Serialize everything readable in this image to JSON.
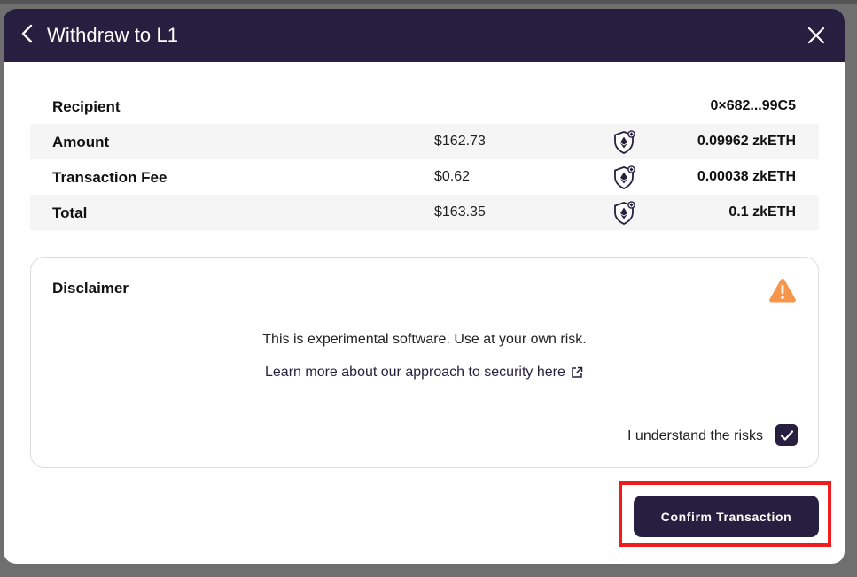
{
  "modal": {
    "title": "Withdraw to L1",
    "back_icon": "chevron-left-icon",
    "close_icon": "close-icon"
  },
  "summary": {
    "rows": [
      {
        "label": "Recipient",
        "usd": "",
        "value": "0×682...99C5",
        "token_icon": ""
      },
      {
        "label": "Amount",
        "usd": "$162.73",
        "value": "0.09962 zkETH",
        "token_icon": "shield-eth-icon"
      },
      {
        "label": "Transaction Fee",
        "usd": "$0.62",
        "value": "0.00038 zkETH",
        "token_icon": "shield-eth-icon"
      },
      {
        "label": "Total",
        "usd": "$163.35",
        "value": "0.1 zkETH",
        "token_icon": "shield-eth-icon"
      }
    ]
  },
  "disclaimer": {
    "title": "Disclaimer",
    "warning_icon": "warning-triangle-icon",
    "text": "This is experimental software. Use at your own risk.",
    "link_text": "Learn more about our approach to security here",
    "link_icon": "external-link-icon",
    "ack_label": "I understand the risks",
    "ack_checked": true
  },
  "actions": {
    "confirm_label": "Confirm Transaction"
  },
  "colors": {
    "header_bg": "#271f3f",
    "accent": "#271f3f",
    "warning": "#f7954a",
    "highlight": "#ee1c1c"
  }
}
